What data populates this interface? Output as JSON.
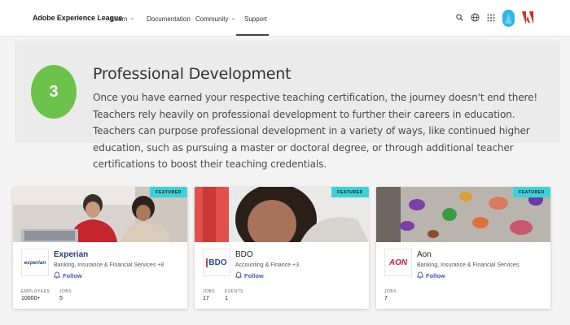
{
  "header": {
    "brand": "Adobe Experience League",
    "nav": [
      {
        "label": "Learn",
        "has_dropdown": true
      },
      {
        "label": "Documentation",
        "has_dropdown": false
      },
      {
        "label": "Community",
        "has_dropdown": true
      },
      {
        "label": "Support",
        "has_dropdown": false,
        "active": true
      }
    ],
    "icons": [
      "search-icon",
      "globe-icon",
      "apps-grid-icon",
      "avatar",
      "adobe-logo"
    ],
    "colors": {
      "avatar": "#2eb6e8",
      "adobe_red": "#e1251b"
    }
  },
  "info": {
    "step_number": "3",
    "title": "Professional Development",
    "body": "Once you have earned your respective teaching certification, the journey doesn't end there! Teachers rely heavily on professional development to further their careers in education. Teachers can purpose professional development in a variety of ways, like continued higher education, such as pursuing a master or doctoral degree, or through additional teacher certifications to boost their teaching credentials.",
    "colors": {
      "step_circle": "#6cc24a",
      "panel_bg": "#ebebeb"
    }
  },
  "cards": [
    {
      "badge": "FEATURED",
      "logo_text": "experian",
      "name": "Experian",
      "industry": "Banking, Insurance & Financial Services +8",
      "follow_label": "Follow",
      "stats": [
        {
          "label": "EMPLOYEES",
          "value": "10000+"
        },
        {
          "label": "JOBS",
          "value": "5"
        }
      ]
    },
    {
      "badge": "FEATURED",
      "logo_text": "BDO",
      "name": "BDO",
      "industry": "Accounting & Finance +3",
      "follow_label": "Follow",
      "stats": [
        {
          "label": "JOBS",
          "value": "17"
        },
        {
          "label": "EVENTS",
          "value": "1"
        }
      ]
    },
    {
      "badge": "FEATURED",
      "logo_text": "AON",
      "name": "Aon",
      "industry": "Banking, Insurance & Financial Services",
      "follow_label": "Follow",
      "stats": [
        {
          "label": "JOBS",
          "value": "7"
        }
      ]
    }
  ],
  "accent": {
    "featured_badge": "#3ed2d8",
    "follow": "#5252d4",
    "company_link": "#1e3a8a"
  }
}
